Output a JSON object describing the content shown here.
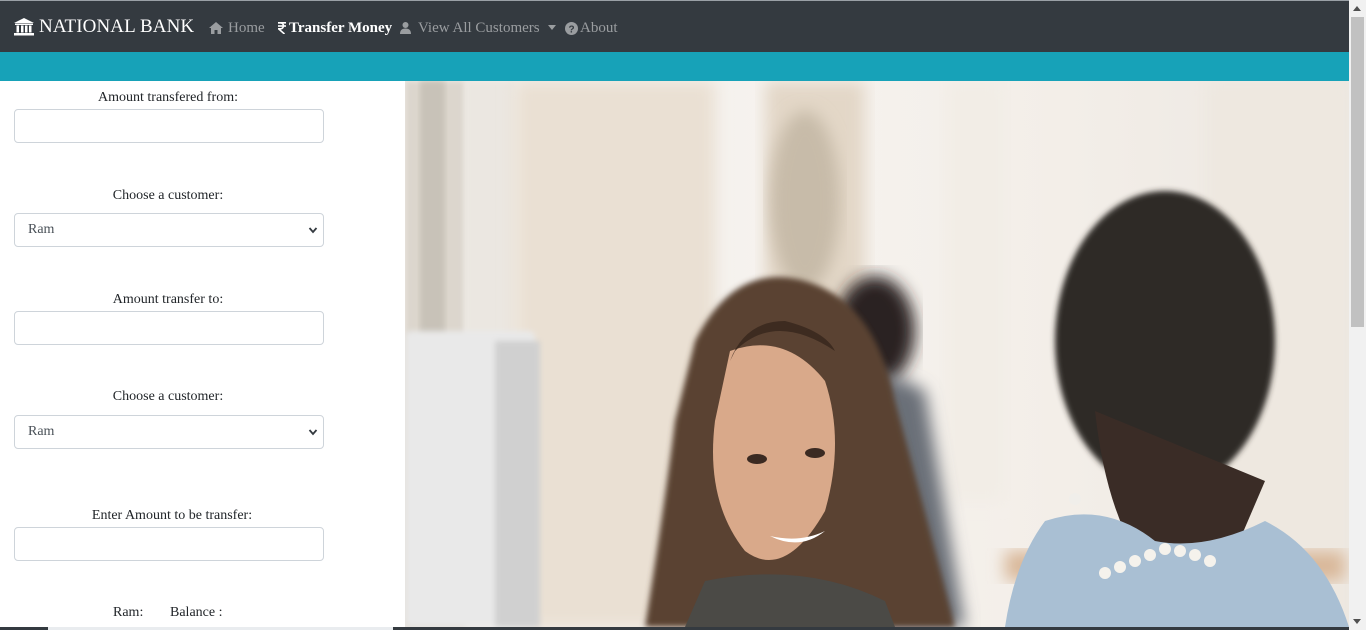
{
  "navbar": {
    "brand": "NATIONAL BANK",
    "brand_icon": "bank-icon",
    "items": [
      {
        "label": "Home",
        "icon": "home-icon"
      },
      {
        "label": "Transfer Money",
        "icon": "rupee-icon",
        "active": true
      },
      {
        "label": "View All Customers",
        "icon": "user-icon",
        "dropdown": true
      },
      {
        "label": "About",
        "icon": "question-circle-icon"
      }
    ]
  },
  "form": {
    "from_label": "Amount transfered from:",
    "from_value": "",
    "customer_label_1": "Choose a customer:",
    "customer_select_1": "Ram",
    "to_label": "Amount transfer to:",
    "to_value": "",
    "customer_label_2": "Choose a customer:",
    "customer_select_2": "Ram",
    "amount_label": "Enter Amount to be transfer:",
    "amount_value": "",
    "balance_name": "Ram:",
    "balance_label": "Balance :"
  },
  "colors": {
    "navbar": "#343a40",
    "accent": "#17a2b8"
  }
}
